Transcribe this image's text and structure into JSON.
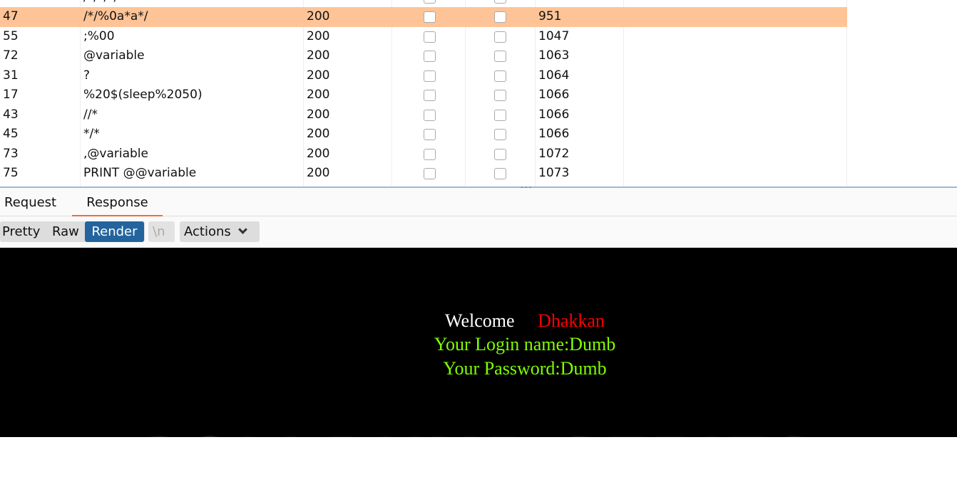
{
  "results": {
    "rows": [
      {
        "num": "",
        "payload": "/*/*/*/",
        "status": "",
        "length": "",
        "partial": true
      },
      {
        "num": "47",
        "payload": "/*/%0a*a*/",
        "status": "200",
        "length": "951",
        "selected": true
      },
      {
        "num": "55",
        "payload": ";%00",
        "status": "200",
        "length": "1047"
      },
      {
        "num": "72",
        "payload": "@variable",
        "status": "200",
        "length": "1063"
      },
      {
        "num": "31",
        "payload": "?",
        "status": "200",
        "length": "1064"
      },
      {
        "num": "17",
        "payload": "%20$(sleep%2050)",
        "status": "200",
        "length": "1066"
      },
      {
        "num": "43",
        "payload": "//*",
        "status": "200",
        "length": "1066"
      },
      {
        "num": "45",
        "payload": "*/*",
        "status": "200",
        "length": "1066"
      },
      {
        "num": "73",
        "payload": ",@variable",
        "status": "200",
        "length": "1072"
      },
      {
        "num": "75",
        "payload": "PRINT @@variable",
        "status": "200",
        "length": "1073"
      }
    ]
  },
  "tabs": {
    "request": "Request",
    "response": "Response",
    "active": "response"
  },
  "toolbar": {
    "pretty": "Pretty",
    "raw": "Raw",
    "render": "Render",
    "newline": "\\n",
    "actions": "Actions",
    "active": "render"
  },
  "render": {
    "welcome": "Welcome",
    "name": "Dhakkan",
    "login": "Your Login name:Dumb",
    "password": "Your Password:Dumb",
    "banner": "SQLI DUMB SERIES",
    "colors": {
      "welcome": "#ffffff",
      "name": "#ff0000",
      "info": "#7fff00",
      "background": "#000000"
    }
  },
  "colors": {
    "selected_row": "#fec497",
    "active_button": "#23649e",
    "tab_underline": "#f26b3a"
  }
}
